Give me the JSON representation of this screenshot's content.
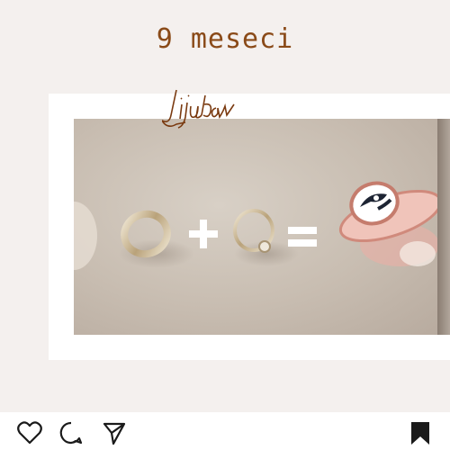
{
  "post": {
    "caption_title": "9 meseci",
    "signature_text": "Ljubav"
  },
  "actions": {
    "like_icon": "heart-icon",
    "comment_icon": "comment-icon",
    "share_icon": "send-icon",
    "save_icon": "bookmark-icon"
  },
  "colors": {
    "title": "#8a4a18",
    "background": "#f4f0ee",
    "signature": "#7a3a10"
  }
}
